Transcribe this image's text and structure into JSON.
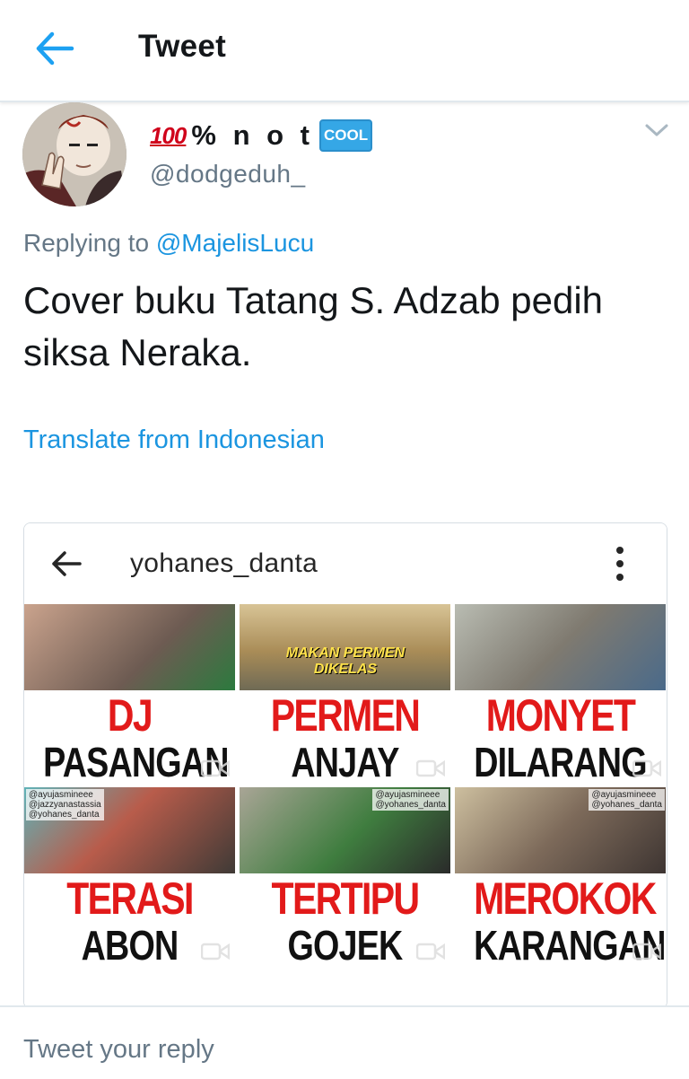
{
  "header": {
    "back_icon": "arrow-left-icon",
    "title": "Tweet",
    "accent_color": "#1da1f2"
  },
  "tweet": {
    "author": {
      "display_name_prefix": "💯",
      "display_name_text": "% n o t",
      "display_name_suffix": "🆒",
      "handle": "@dodgeduh_"
    },
    "more_icon": "chevron-down-icon",
    "replying_to_prefix": "Replying to",
    "replying_to_mention": "@MajelisLucu",
    "text": "Cover buku Tatang S. Adzab pedih siksa Neraka.",
    "translate_label": "Translate from Indonesian"
  },
  "media": {
    "back_icon": "arrow-left-icon",
    "username": "yohanes_danta",
    "more_icon": "more-vertical-icon",
    "tiles": [
      {
        "line1": "DJ",
        "line2": "PASANGAN",
        "tag": "",
        "caption": "",
        "photo_color": "#9c8a7a"
      },
      {
        "line1": "PERMEN",
        "line2": "ANJAY",
        "tag": "",
        "caption": "MAKAN PERMEN\nDIKELAS",
        "photo_color": "#b59a63"
      },
      {
        "line1": "MONYET",
        "line2": "DILARANG",
        "tag": "",
        "caption": "",
        "photo_color": "#8d8f86"
      },
      {
        "line1": "TERASI",
        "line2": "ABON",
        "tag": "@ayujasmineee\n@jazzyanastassia\n@yohanes_danta",
        "caption": "",
        "photo_color": "#7aa3a8"
      },
      {
        "line1": "TERTIPU",
        "line2": "GOJEK",
        "tag": "@ayujasmineee\n@yohanes_danta",
        "caption": "",
        "photo_color": "#8a9488"
      },
      {
        "line1": "MEROKOK",
        "line2": "KARANGAN",
        "tag": "@ayujasmineee\n@yohanes_danta",
        "caption": "",
        "photo_color": "#a79f92"
      }
    ]
  },
  "reply_bar": {
    "placeholder": "Tweet your reply"
  }
}
